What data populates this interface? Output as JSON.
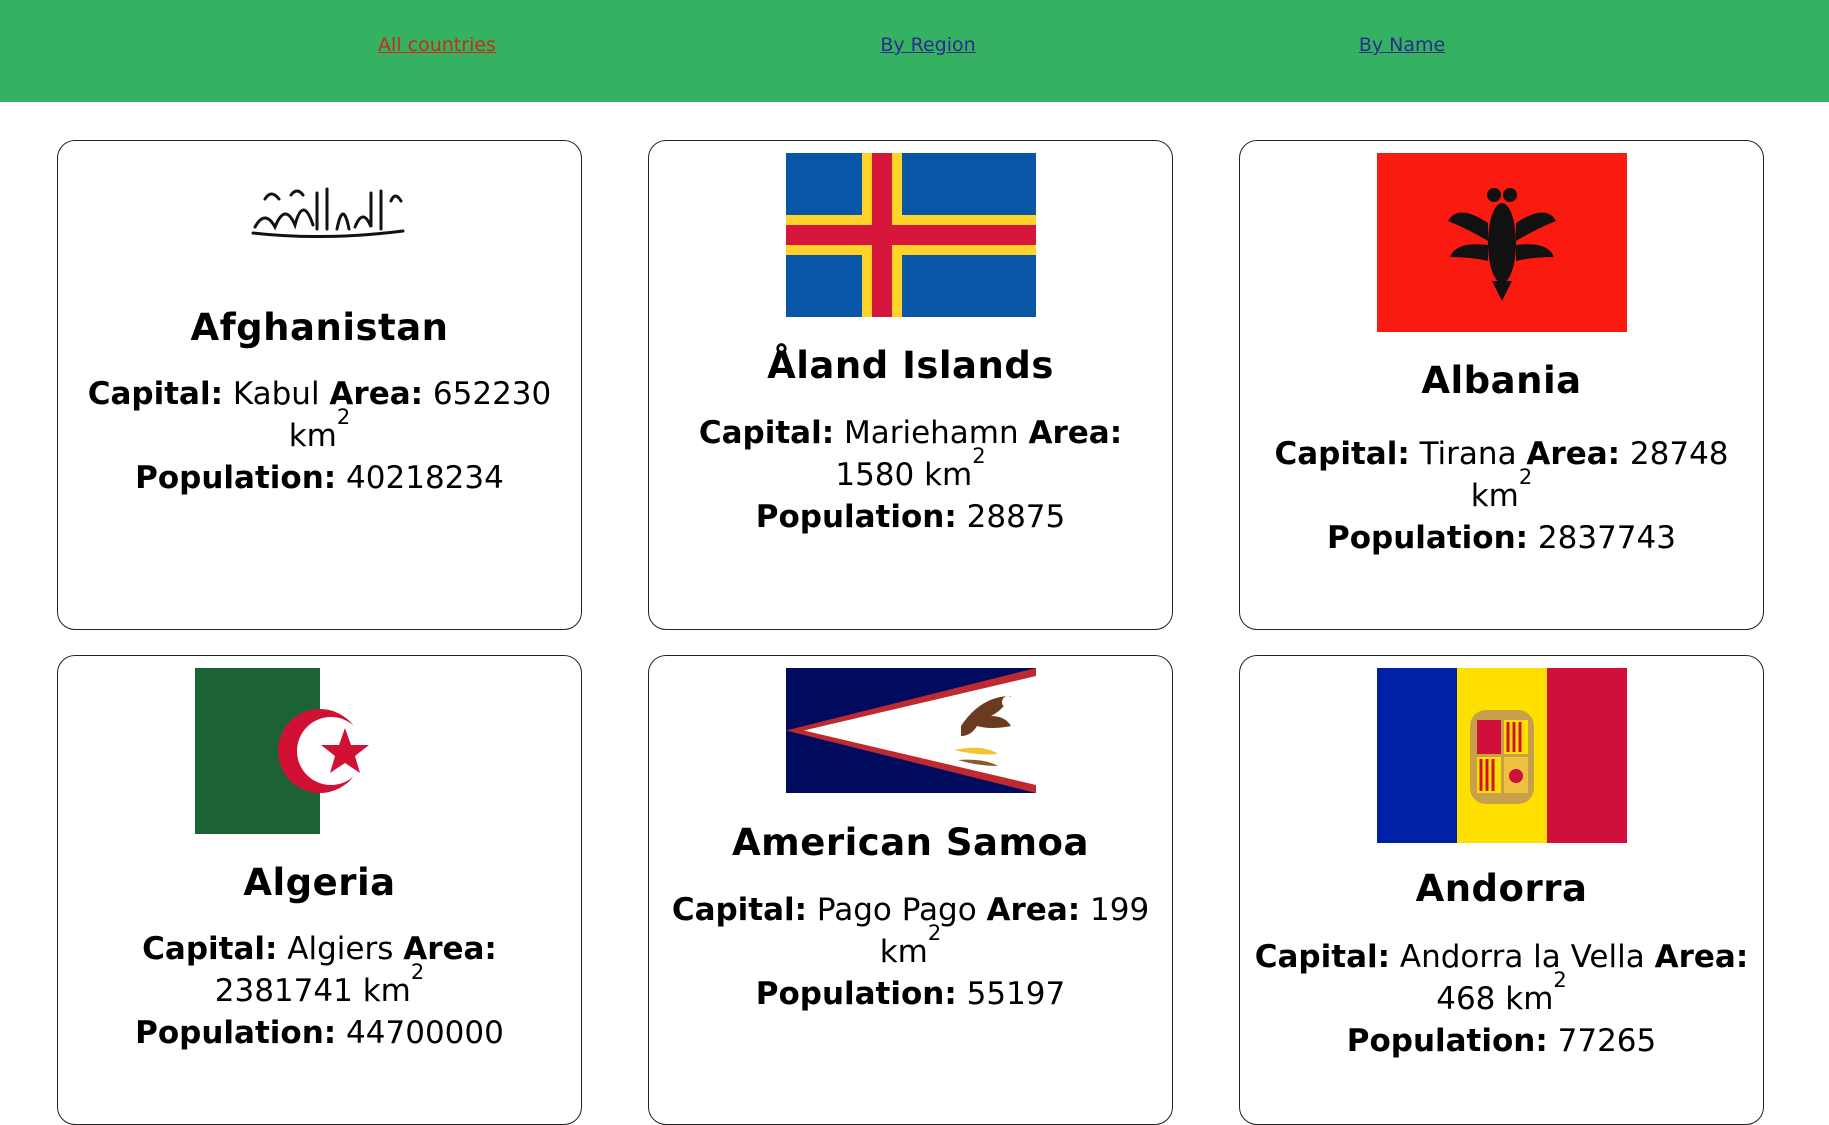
{
  "nav": {
    "all_countries": "All countries",
    "by_region": "By Region",
    "by_name": "By Name"
  },
  "labels": {
    "capital": "Capital:",
    "area": "Area:",
    "population": "Population:",
    "area_unit": "km",
    "area_exp": "2"
  },
  "countries": [
    {
      "name": "Afghanistan",
      "capital": "Kabul",
      "area": "652230",
      "population": "40218234"
    },
    {
      "name": "Åland Islands",
      "capital": "Mariehamn",
      "area": "1580",
      "population": "28875"
    },
    {
      "name": "Albania",
      "capital": "Tirana",
      "area": "28748",
      "population": "2837743"
    },
    {
      "name": "Algeria",
      "capital": "Algiers",
      "area": "2381741",
      "population": "44700000"
    },
    {
      "name": "American Samoa",
      "capital": "Pago Pago",
      "area": "199",
      "population": "55197"
    },
    {
      "name": "Andorra",
      "capital": "Andorra la Vella",
      "area": "468",
      "population": "77265"
    }
  ],
  "colors": {
    "nav_bg": "#34b262",
    "active_link": "#cc2b1a",
    "inactive_link": "#2c2c8c"
  }
}
